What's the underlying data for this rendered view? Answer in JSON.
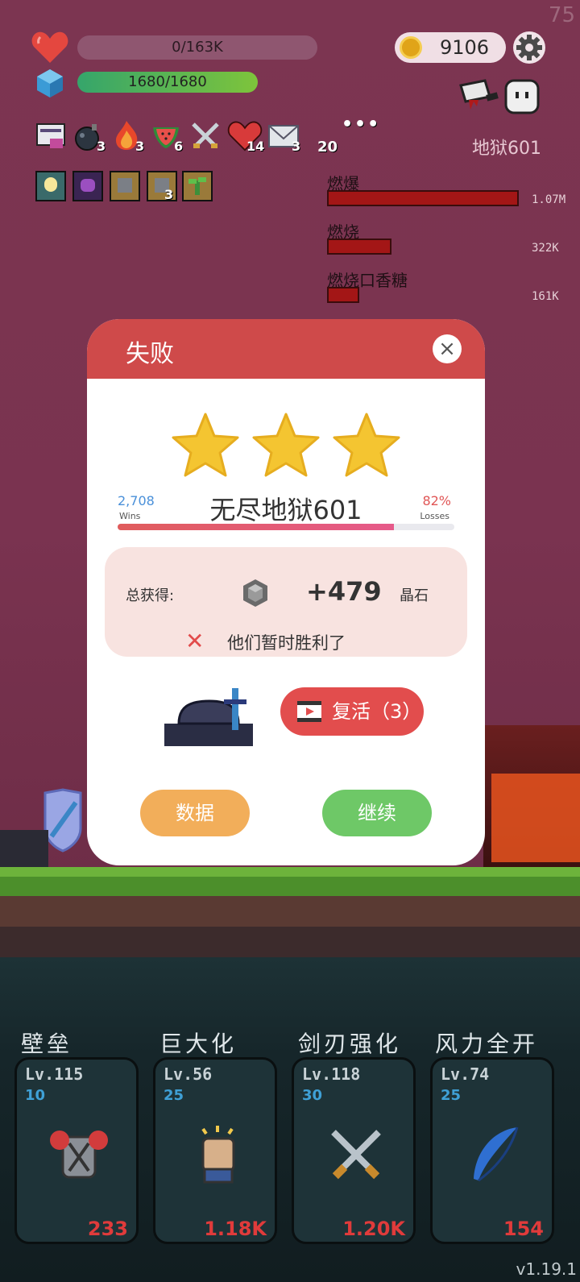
{
  "fps": "75",
  "hud": {
    "hp_text": "0/163K",
    "hp_fraction": 0,
    "shield_text": "1680/1680",
    "shield_fraction": 1.0,
    "coins": "9106",
    "stage_label": "地狱601"
  },
  "items": [
    {
      "icon": "scroll-icon",
      "count": ""
    },
    {
      "icon": "bomb-icon",
      "count": "3"
    },
    {
      "icon": "fire-icon",
      "count": "3"
    },
    {
      "icon": "watermelon-icon",
      "count": "6"
    },
    {
      "icon": "crossed-swords-icon",
      "count": ""
    },
    {
      "icon": "heart-icon",
      "count": "14"
    },
    {
      "icon": "envelope-icon",
      "count": "3"
    },
    {
      "icon": "more-icon",
      "count": "20"
    }
  ],
  "buffs": [
    {
      "icon": "lightbulb-buff-icon",
      "count": ""
    },
    {
      "icon": "demon-buff-icon",
      "count": ""
    },
    {
      "icon": "armor-buff-icon",
      "count": ""
    },
    {
      "icon": "armor-buff-icon",
      "count": "3"
    },
    {
      "icon": "sprout-buff-icon",
      "count": ""
    }
  ],
  "damage_stats": [
    {
      "label": "燃爆",
      "value": "1.07M",
      "fraction": 1.0
    },
    {
      "label": "燃烧",
      "value": "322K",
      "fraction": 0.34
    },
    {
      "label": "燃烧口香糖",
      "value": "161K",
      "fraction": 0.17
    }
  ],
  "modal": {
    "title": "失败",
    "stars": 3,
    "stage_name": "无尽地狱601",
    "wins_count": "2,708",
    "wins_label": "Wins",
    "losses_pct": "82%",
    "losses_label": "Losses",
    "ratio_fraction": 0.82,
    "reward_label": "总获得:",
    "reward_value": "+479",
    "reward_unit": "晶石",
    "fail_message": "他们暂时胜利了",
    "revive_label": "复活（3）",
    "data_button": "数据",
    "continue_button": "继续"
  },
  "skills": [
    {
      "title": "壁垒",
      "level": "Lv.115",
      "cost": "10",
      "price": "233",
      "icon": "armor-icon"
    },
    {
      "title": "巨大化",
      "level": "Lv.56",
      "cost": "25",
      "price": "1.18K",
      "icon": "fist-icon"
    },
    {
      "title": "剑刃强化",
      "level": "Lv.118",
      "cost": "30",
      "price": "1.20K",
      "icon": "crossed-swords-icon"
    },
    {
      "title": "风力全开",
      "level": "Lv.74",
      "cost": "25",
      "price": "154",
      "icon": "feather-icon"
    }
  ],
  "version": "v1.19.1",
  "colors": {
    "modal_header": "#cf4a4a",
    "star": "#f4c531",
    "revive": "#e24d4d",
    "data_btn": "#f2ae5a",
    "continue_btn": "#6ec867"
  }
}
